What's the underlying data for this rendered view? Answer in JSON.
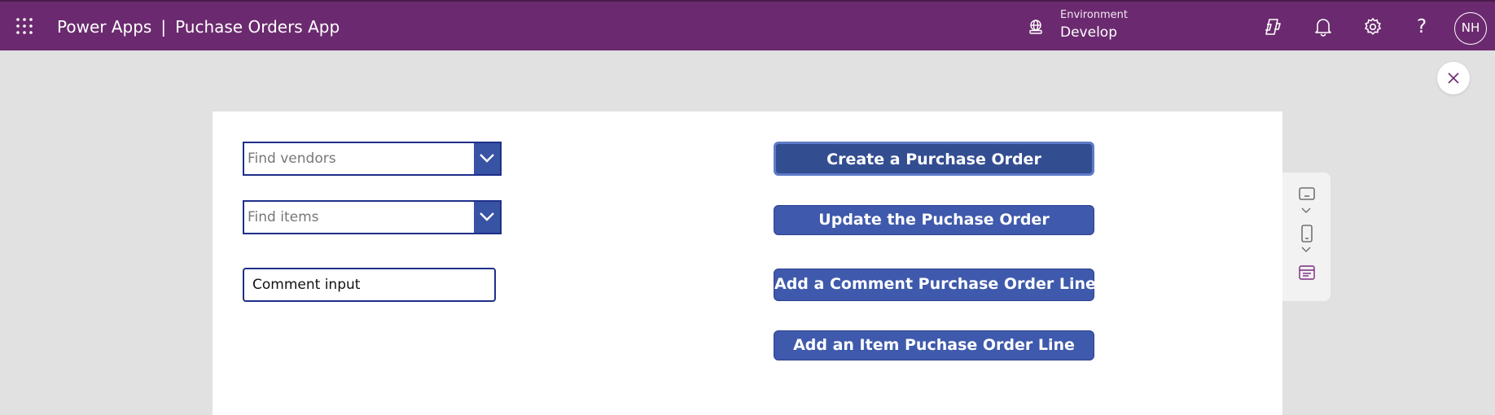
{
  "header": {
    "product": "Power Apps",
    "separator": "|",
    "app_name": "Puchase Orders App",
    "environment_label": "Environment",
    "environment_value": "Develop",
    "avatar_initials": "NH",
    "help_glyph": "?",
    "icons": [
      "app-launcher-icon",
      "environment-icon",
      "copilot-icon",
      "notifications-icon",
      "settings-icon",
      "help-icon"
    ],
    "bg_color": "#6b2a6f"
  },
  "canvas": {
    "vendor_combo": {
      "placeholder": "Find vendors"
    },
    "items_combo": {
      "placeholder": "Find items"
    },
    "comment_input": {
      "value": "Comment input"
    },
    "buttons": [
      {
        "label": "Create a Purchase Order"
      },
      {
        "label": "Update the Puchase Order"
      },
      {
        "label": "Add a Comment Purchase Order Line"
      },
      {
        "label": "Add an Item Puchase Order Line"
      }
    ],
    "accent_color": "#3f5aac"
  },
  "side_panel": {
    "icons": [
      "tablet-layout-icon",
      "chevron-down-icon",
      "phone-layout-icon",
      "chevron-down-icon",
      "web-layout-icon"
    ]
  }
}
